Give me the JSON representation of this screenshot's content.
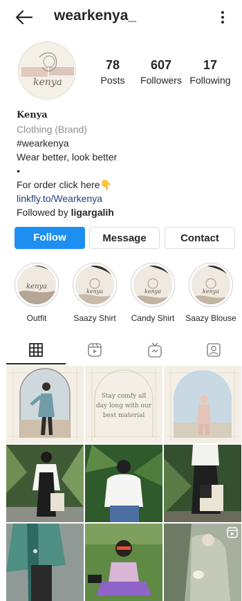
{
  "header": {
    "username": "wearkenya_",
    "back_icon": "arrow-left-icon",
    "more_icon": "more-vertical-icon"
  },
  "profile": {
    "avatar_text": "kenya",
    "stats": {
      "posts": {
        "value": "78",
        "label": "Posts"
      },
      "followers": {
        "value": "607",
        "label": "Followers"
      },
      "following": {
        "value": "17",
        "label": "Following"
      }
    },
    "name": "Kenya",
    "category": "Clothing (Brand)",
    "bio_lines": [
      "#wearkenya",
      "Wear better, look better",
      "•",
      "For order click here"
    ],
    "order_emoji": "👇",
    "link": "linkfly.to/Wearkenya",
    "followed_by_prefix": "Followed by ",
    "followed_by_user": "ligargalih"
  },
  "actions": {
    "follow": "Follow",
    "message": "Message",
    "contact": "Contact"
  },
  "highlights": [
    {
      "label": "Outfit",
      "cover_text": "kenya"
    },
    {
      "label": "Saazy Shirt",
      "cover_text": "kenya"
    },
    {
      "label": "Candy Shirt",
      "cover_text": "kenya"
    },
    {
      "label": "Saazy Blouse",
      "cover_text": "kenya"
    }
  ],
  "tabs": [
    {
      "icon": "grid-icon",
      "active": true
    },
    {
      "icon": "reels-icon",
      "active": false
    },
    {
      "icon": "igtv-icon",
      "active": false
    },
    {
      "icon": "tagged-user-icon",
      "active": false
    }
  ],
  "posts": {
    "quote_lines": [
      "Stay comfy all",
      "day long with our",
      "best material"
    ],
    "reel_icon": "reel-badge-icon"
  },
  "colors": {
    "accent_blue": "#1d8ff0",
    "link_blue": "#1f3d7a",
    "muted_gray": "#8e8e8e",
    "cream": "#f3efe6"
  }
}
